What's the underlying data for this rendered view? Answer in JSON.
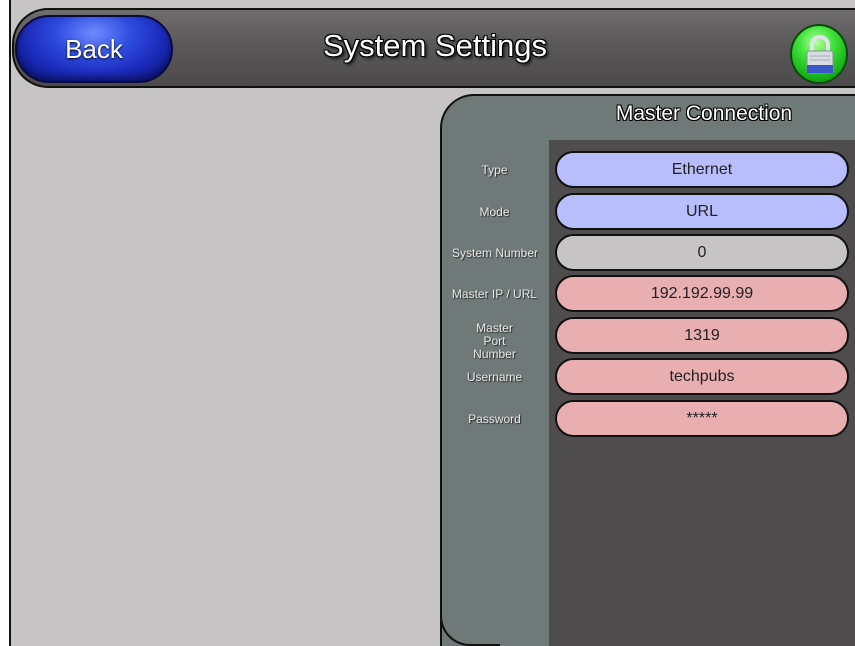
{
  "header": {
    "back_label": "Back",
    "title": "System Settings",
    "lock_icon": "padlock-icon"
  },
  "panel": {
    "title": "Master Connection",
    "fields": [
      {
        "label": "Type",
        "value": "Ethernet",
        "color": "#b8bdfb"
      },
      {
        "label": "Mode",
        "value": "URL",
        "color": "#b8bdfb"
      },
      {
        "label": "System Number",
        "value": "0",
        "color": "#c6c4c4"
      },
      {
        "label": "Master IP / URL",
        "value": "192.192.99.99",
        "color": "#e8aeb0"
      },
      {
        "label": "Master Port Number",
        "value": "1319",
        "color": "#e8aeb0"
      },
      {
        "label": "Username",
        "value": "techpubs",
        "color": "#e8aeb0"
      },
      {
        "label": "Password",
        "value": "*****",
        "color": "#e8aeb0"
      }
    ]
  },
  "colors": {
    "back_button": "#1b2ab8",
    "lock_button": "#17b216",
    "panel_side": "#6e7978",
    "panel_body": "#4e4c4c",
    "background": "#c6c4c4"
  }
}
